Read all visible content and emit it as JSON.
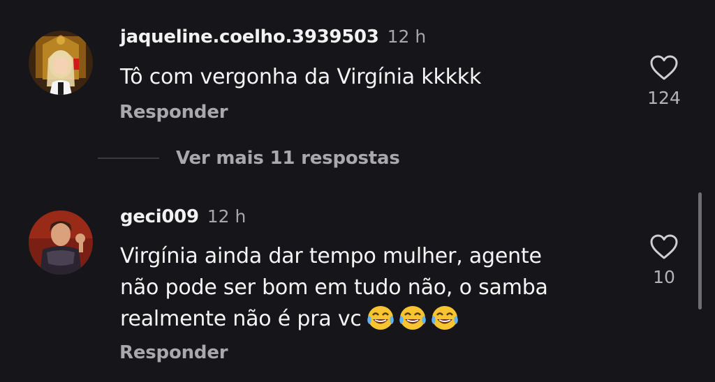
{
  "comments": [
    {
      "username": "jaqueline.coelho.3939503",
      "time": "12 h",
      "text": "Tô com vergonha  da Virgínia  kkkkk",
      "reply_label": "Responder",
      "likes": "124"
    },
    {
      "username": "geci009",
      "time": "12 h",
      "text_lines": [
        "Virgínia ainda dar tempo mulher, agente",
        "não pode ser bom em tudo não, o samba",
        "realmente não é pra vc"
      ],
      "emojis": [
        "face-with-tears-of-joy",
        "face-with-tears-of-joy",
        "face-with-tears-of-joy"
      ],
      "reply_label": "Responder",
      "likes": "10"
    }
  ],
  "more_replies": "Ver mais 11 respostas",
  "colors": {
    "background": "#16161a",
    "secondary_text": "#a8a8ad",
    "emoji_face": "#f7c531"
  }
}
